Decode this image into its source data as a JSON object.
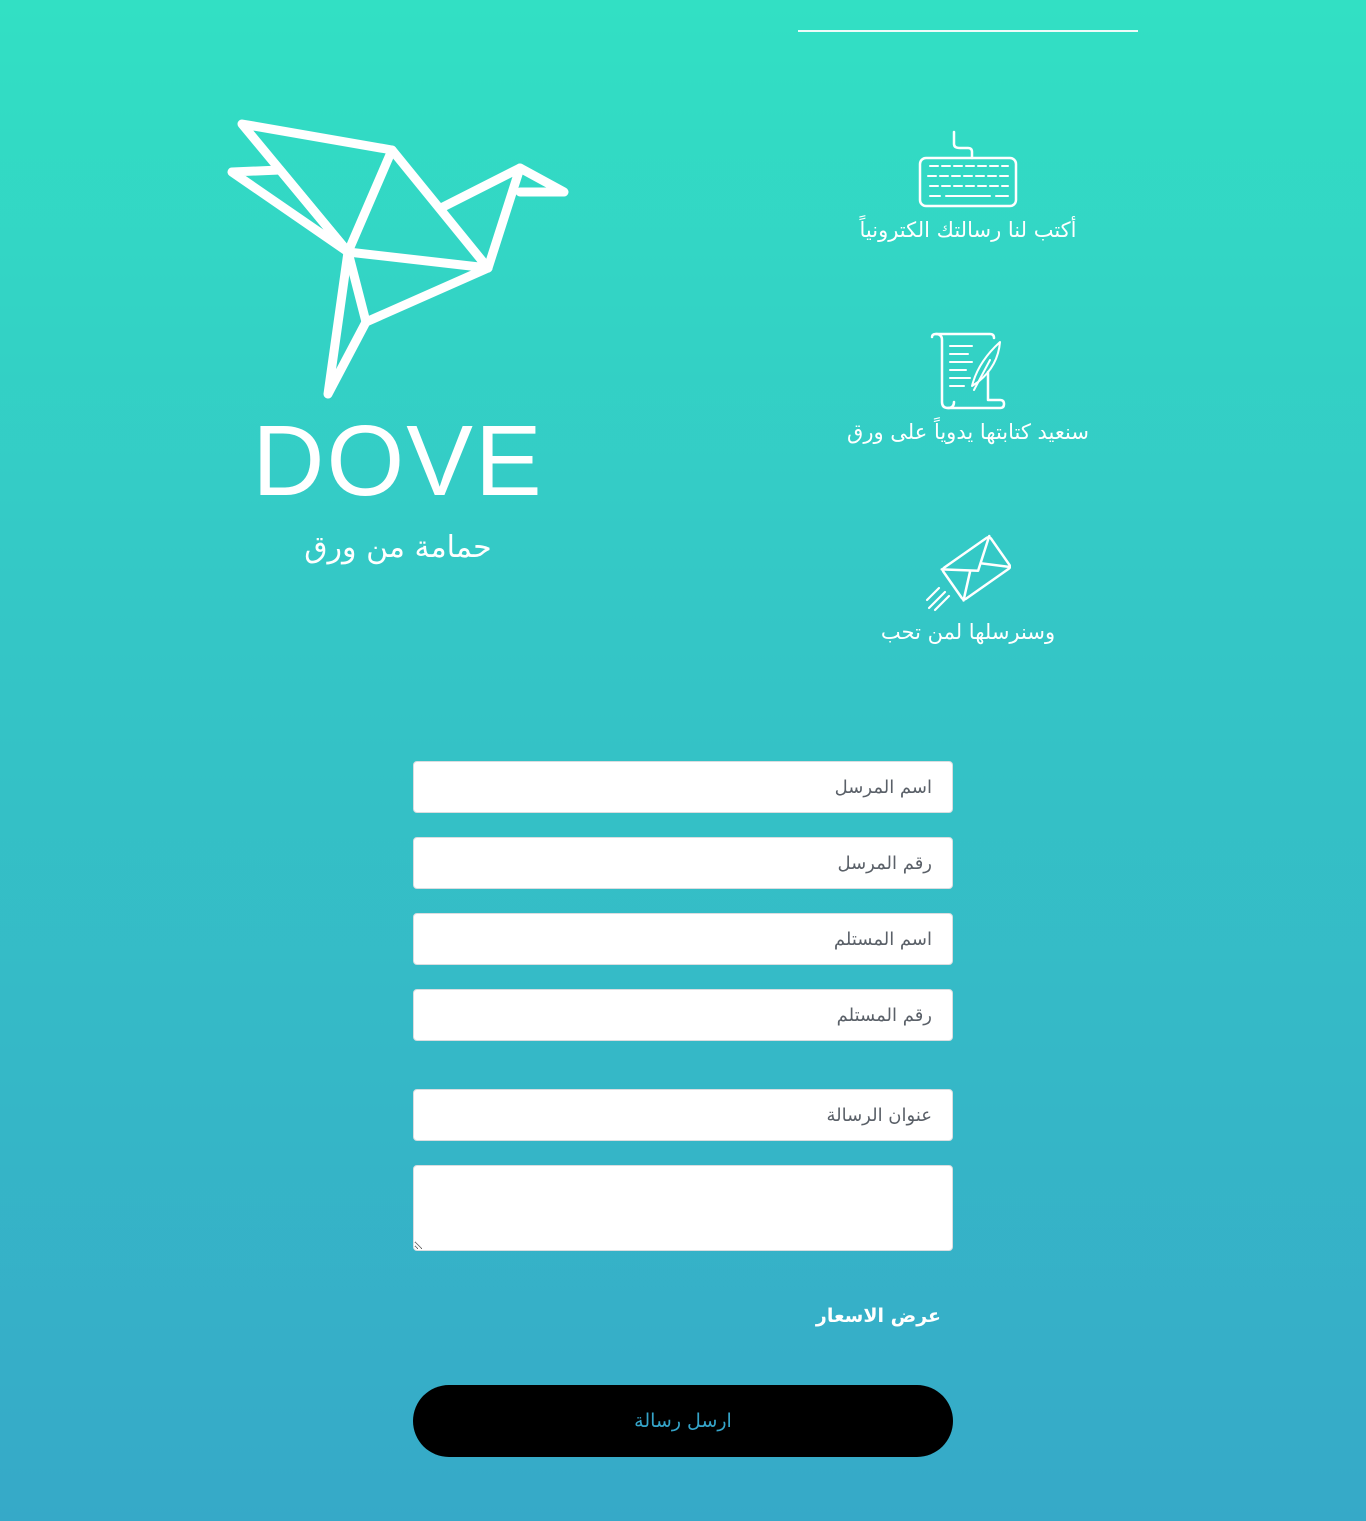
{
  "brand": {
    "name": "DOVE",
    "tagline": "حمامة من ورق"
  },
  "features": [
    {
      "icon": "keyboard-icon",
      "label": "أكتب لنا رسالتك الكترونياً"
    },
    {
      "icon": "scroll-quill-icon",
      "label": "سنعيد كتابتها يدوياً على ورق"
    },
    {
      "icon": "flying-envelope-icon",
      "label": "وسنرسلها لمن تحب"
    }
  ],
  "form": {
    "sender_name_placeholder": "اسم المرسل",
    "sender_number_placeholder": "رقم المرسل",
    "recipient_name_placeholder": "اسم المستلم",
    "recipient_number_placeholder": "رقم المستلم",
    "subject_placeholder": "عنوان الرسالة",
    "message_value": "",
    "prices_link": "عرض الاسعار",
    "send_label": "ارسل رسالة"
  },
  "colors": {
    "gradient_top": "#32e0c4",
    "gradient_bottom": "#36a9c8",
    "button_bg": "#000000",
    "button_text": "#35a4c9"
  }
}
